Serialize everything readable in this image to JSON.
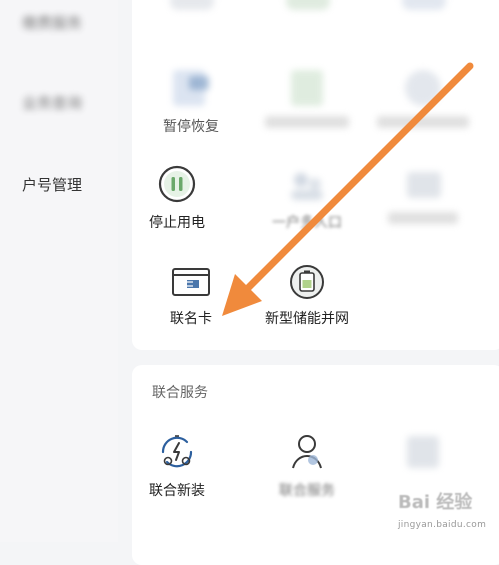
{
  "sidebar": {
    "items": [
      {
        "label": "缴费服务",
        "blurred": true
      },
      {
        "label": "业务查询",
        "blurred": true
      },
      {
        "label": "户号管理",
        "blurred": false
      }
    ]
  },
  "services": {
    "row_top": [
      {
        "label": "",
        "icon": "blurred-icon"
      },
      {
        "label": "",
        "icon": "blurred-icon"
      },
      {
        "label": "",
        "icon": "blurred-icon"
      }
    ],
    "row1": [
      {
        "label": "暂停恢复",
        "icon": "pause-resume-icon"
      },
      {
        "label": "",
        "icon": "blurred-icon"
      },
      {
        "label": "",
        "icon": "blurred-icon"
      }
    ],
    "row2": [
      {
        "label": "停止用电",
        "icon": "pause-circle-icon"
      },
      {
        "label": "一户多人口",
        "icon": "multi-person-icon"
      },
      {
        "label": "",
        "icon": "blurred-icon"
      }
    ],
    "row3": [
      {
        "label": "联名卡",
        "icon": "co-branded-card-icon"
      },
      {
        "label": "新型储能并网",
        "icon": "energy-storage-icon"
      }
    ]
  },
  "joint": {
    "title": "联合服务",
    "items": [
      {
        "label": "联合新装",
        "icon": "joint-install-icon"
      },
      {
        "label": "联合服务",
        "icon": "person-icon"
      },
      {
        "label": "",
        "icon": "blurred-icon"
      }
    ]
  },
  "watermark": {
    "logo": "Bai 经验",
    "url": "jingyan.baidu.com"
  },
  "colors": {
    "accent_orange": "#f08a3c",
    "icon_green": "#6aa86a",
    "icon_blue": "#2c5f9e",
    "icon_dark": "#3a3a3a"
  }
}
